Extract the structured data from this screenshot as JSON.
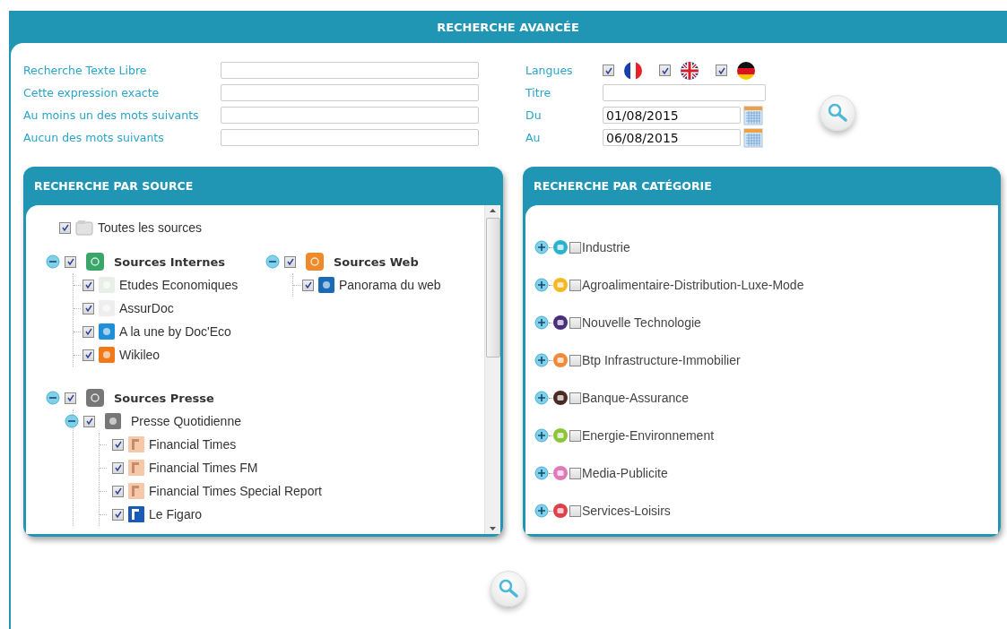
{
  "title": "RECHERCHE AVANCÉE",
  "text_fields": [
    {
      "label": "Recherche Texte Libre"
    },
    {
      "label": "Cette expression exacte"
    },
    {
      "label": "Au moins un des mots suivants"
    },
    {
      "label": "Aucun des mots suivants"
    }
  ],
  "languages": {
    "label": "Langues",
    "items": [
      {
        "checked": true
      },
      {
        "checked": true
      },
      {
        "checked": true
      }
    ]
  },
  "title_field": {
    "label": "Titre"
  },
  "date_fields": [
    {
      "label": "Du",
      "value": "01/08/2015"
    },
    {
      "label": "Au",
      "value": "06/08/2015"
    }
  ],
  "source_panel": {
    "title": "RECHERCHE PAR SOURCE",
    "all": {
      "label": "Toutes les sources",
      "checked": true
    },
    "groups": [
      {
        "label": "Sources Internes",
        "checked": true,
        "expanded": true,
        "children": [
          {
            "label": "Etudes Economiques",
            "checked": true
          },
          {
            "label": "AssurDoc",
            "checked": true
          },
          {
            "label": "A la une by Doc'Eco",
            "checked": true
          },
          {
            "label": "Wikileo",
            "checked": true
          }
        ]
      },
      {
        "label": "Sources Web",
        "checked": true,
        "expanded": true,
        "children": [
          {
            "label": "Panorama du web",
            "checked": true
          }
        ]
      },
      {
        "label": "Sources Presse",
        "checked": true,
        "expanded": true,
        "children": [
          {
            "label": "Presse Quotidienne",
            "checked": true,
            "expanded": true,
            "children": [
              {
                "label": "Financial Times",
                "checked": true
              },
              {
                "label": "Financial Times FM",
                "checked": true
              },
              {
                "label": "Financial Times Special Report",
                "checked": true
              },
              {
                "label": "Le Figaro",
                "checked": true
              }
            ]
          }
        ]
      }
    ]
  },
  "category_panel": {
    "title": "RECHERCHE PAR CATÉGORIE",
    "items": [
      {
        "label": "Industrie",
        "checked": false,
        "expanded": false,
        "color": "#29b3cc"
      },
      {
        "label": "Agroalimentaire-Distribution-Luxe-Mode",
        "checked": false,
        "expanded": false,
        "color": "#f5b820"
      },
      {
        "label": "Nouvelle Technologie",
        "checked": false,
        "expanded": false,
        "color": "#4a2e7a"
      },
      {
        "label": "Btp Infrastructure-Immobilier",
        "checked": false,
        "expanded": false,
        "color": "#f08a3a"
      },
      {
        "label": "Banque-Assurance",
        "checked": false,
        "expanded": false,
        "color": "#4a2a22"
      },
      {
        "label": "Energie-Environnement",
        "checked": false,
        "expanded": false,
        "color": "#8cc43a"
      },
      {
        "label": "Media-Publicite",
        "checked": false,
        "expanded": false,
        "color": "#e07ab8"
      },
      {
        "label": "Services-Loisirs",
        "checked": false,
        "expanded": false,
        "color": "#e0404a"
      }
    ]
  }
}
